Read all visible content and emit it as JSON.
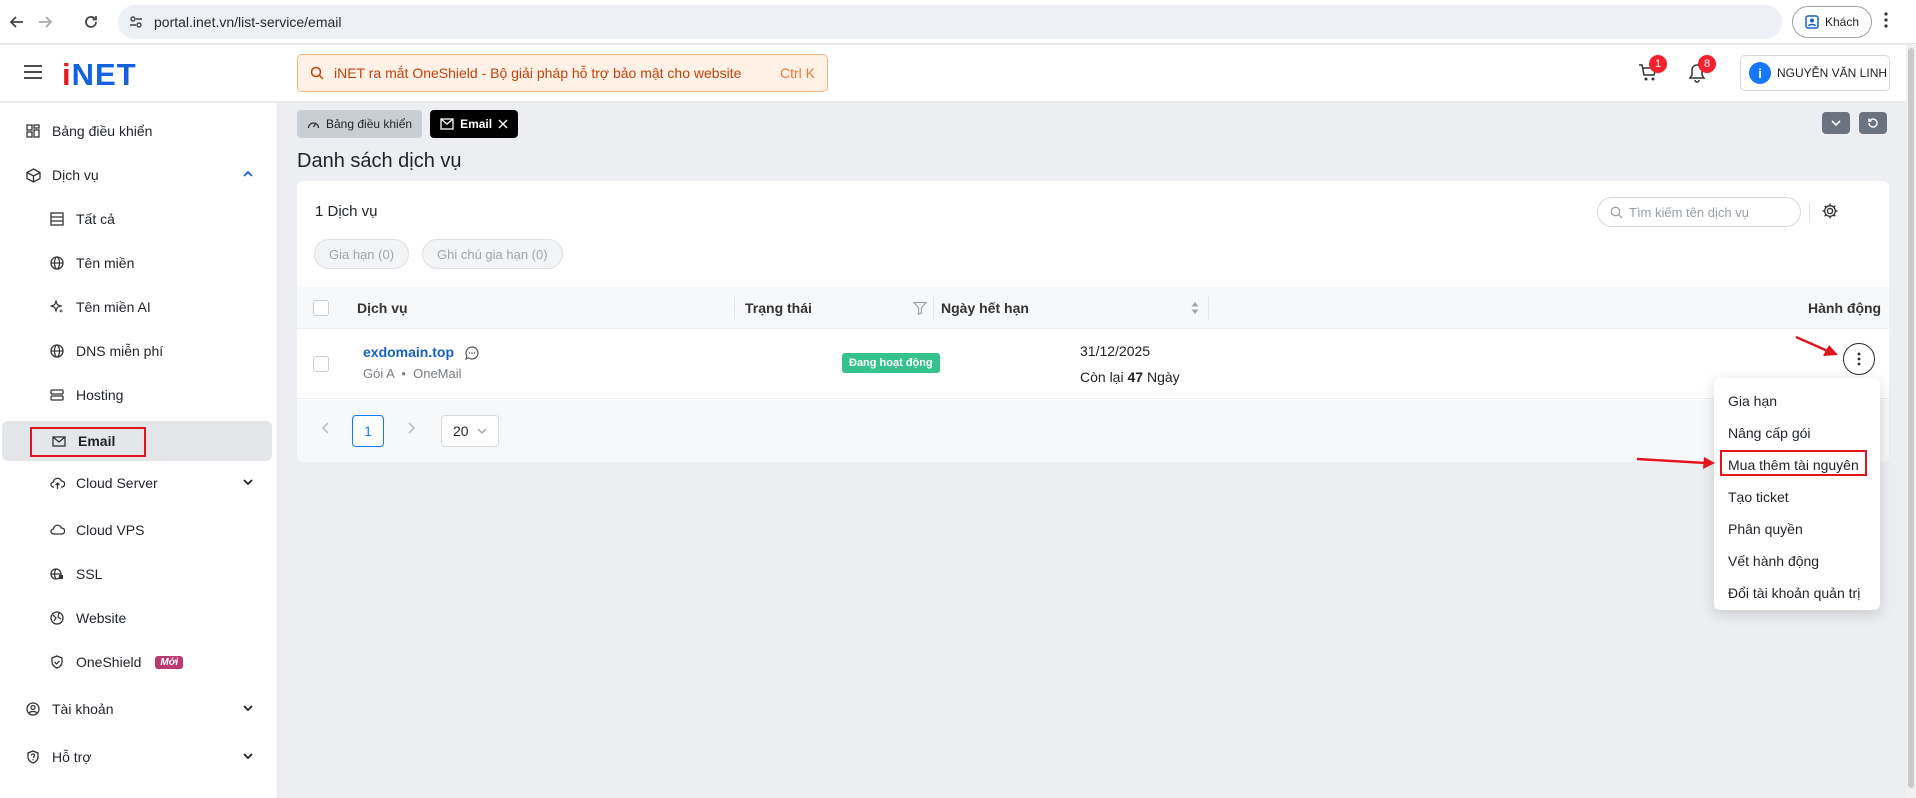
{
  "browser": {
    "url": "portal.inet.vn/list-service/email",
    "guest_label": "Khách"
  },
  "header": {
    "logo": "iNET",
    "promo_text": "iNET ra mắt OneShield - Bộ giải pháp hỗ trợ bảo mật cho website",
    "promo_shortcut": "Ctrl K",
    "cart_count": "1",
    "notification_count": "8",
    "user_name": "NGUYỄN VĂN LINH"
  },
  "sidebar": {
    "items": [
      {
        "label": "Bảng điều khiển",
        "icon": "dashboard-icon"
      },
      {
        "label": "Dịch vụ",
        "icon": "box-icon"
      },
      {
        "label": "Tất cả",
        "icon": "list-icon"
      },
      {
        "label": "Tên miền",
        "icon": "globe-icon"
      },
      {
        "label": "Tên miền AI",
        "icon": "sparkle-icon"
      },
      {
        "label": "DNS miễn phí",
        "icon": "globe-icon"
      },
      {
        "label": "Hosting",
        "icon": "server-icon"
      },
      {
        "label": "Email",
        "icon": "mail-icon"
      },
      {
        "label": "Cloud Server",
        "icon": "cloud-icon"
      },
      {
        "label": "Cloud VPS",
        "icon": "cloud-icon"
      },
      {
        "label": "SSL",
        "icon": "globe-lock-icon"
      },
      {
        "label": "Website",
        "icon": "web-icon"
      },
      {
        "label": "OneShield",
        "icon": "shield-icon"
      },
      {
        "label": "Tài khoản",
        "icon": "user-icon"
      },
      {
        "label": "Hỗ trợ",
        "icon": "help-icon"
      }
    ],
    "new_tag": "Mới"
  },
  "tabs": {
    "dashboard": "Bảng điều khiển",
    "email": "Email"
  },
  "main": {
    "title": "Danh sách dịch vụ",
    "count": "1 Dịch vụ",
    "search_placeholder": "Tìm kiếm tên dịch vụ",
    "filter_renew": "Gia hạn (0)",
    "filter_note": "Ghi chú gia hạn (0)",
    "columns": {
      "service": "Dịch vụ",
      "status": "Trạng thái",
      "expiry": "Ngày hết hạn",
      "action": "Hành động"
    },
    "rows": [
      {
        "domain": "exdomain.top",
        "package": "Gói A",
        "product": "OneMail",
        "status": "Đang hoạt động",
        "expiry": "31/12/2025",
        "remaining_prefix": "Còn lại",
        "remaining_days": "47",
        "remaining_suffix": "Ngày"
      }
    ],
    "pagination": {
      "current": "1",
      "page_size": "20"
    }
  },
  "action_menu": {
    "items": [
      "Gia hạn",
      "Nâng cấp gói",
      "Mua thêm tài nguyên",
      "Tạo ticket",
      "Phân quyền",
      "Vết hành động",
      "Đổi tài khoản quản trị"
    ]
  },
  "colors": {
    "brand": "#1461e0",
    "status_active": "#36c28c",
    "annotation": "#e3141d"
  }
}
